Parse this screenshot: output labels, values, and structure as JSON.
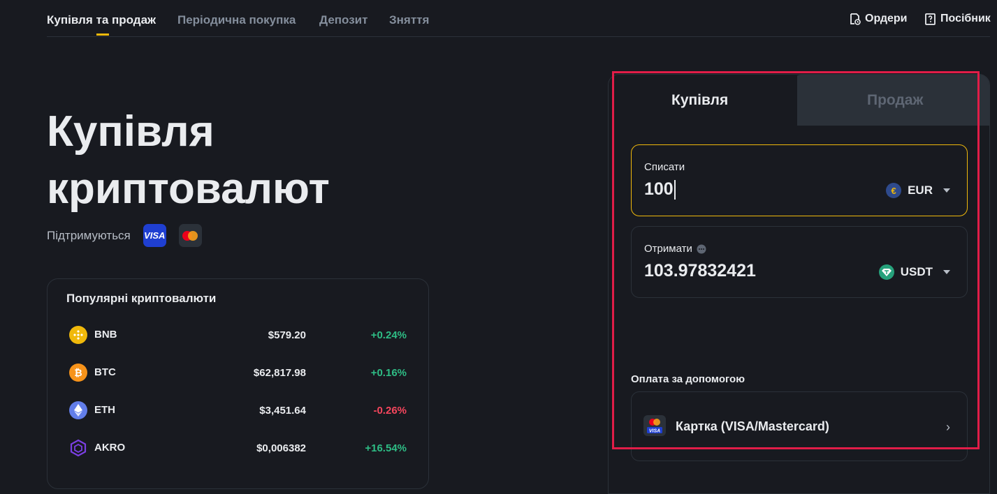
{
  "nav": {
    "tabs": [
      "Купівля та продаж",
      "Періодична покупка",
      "Депозит",
      "Зняття"
    ],
    "orders": "Ордери",
    "guide": "Посібник"
  },
  "hero": {
    "title_line1": "Купівля",
    "title_line2": "криптовалют",
    "supported": "Підтримуються",
    "visa": "VISA"
  },
  "popular": {
    "title": "Популярні криптовалюти",
    "rows": [
      {
        "name": "BNB",
        "price": "$579.20",
        "change": "+0.24%",
        "dir": "up",
        "color": "#f0b90b"
      },
      {
        "name": "BTC",
        "price": "$62,817.98",
        "change": "+0.16%",
        "dir": "up",
        "color": "#f7931a"
      },
      {
        "name": "ETH",
        "price": "$3,451.64",
        "change": "-0.26%",
        "dir": "down",
        "color": "#627eea"
      },
      {
        "name": "AKRO",
        "price": "$0,006382",
        "change": "+16.54%",
        "dir": "up",
        "color": "#6b2fbf"
      }
    ]
  },
  "trade": {
    "buy_tab": "Купівля",
    "sell_tab": "Продаж",
    "spend_label": "Списати",
    "spend_value": "100",
    "spend_currency": "EUR",
    "receive_label": "Отримати",
    "receive_value": "103.97832421",
    "receive_currency": "USDT",
    "pay_label": "Оплата за допомогою",
    "pay_method": "Картка (VISA/Mastercard)",
    "card_visa": "VISA"
  },
  "colors": {
    "accent": "#f0b90b",
    "up": "#2ebd85",
    "down": "#f6465d",
    "highlight": "#e11d48"
  }
}
